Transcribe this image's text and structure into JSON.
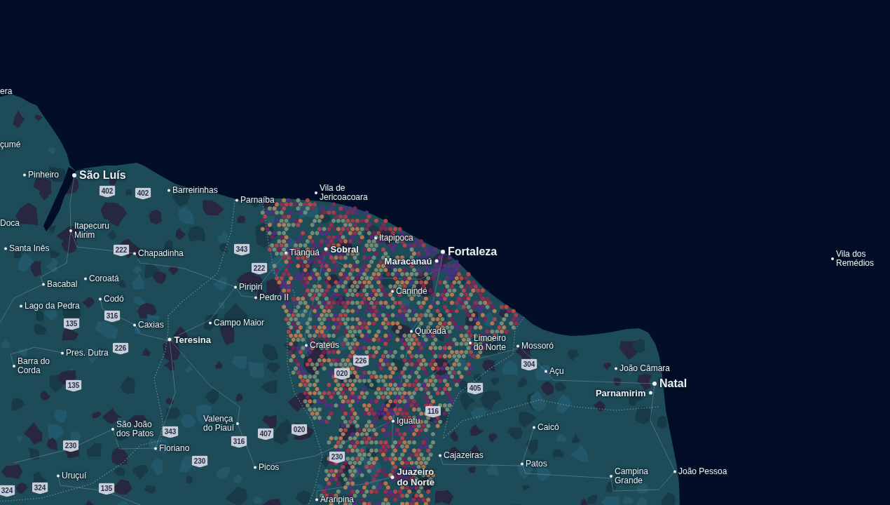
{
  "map": {
    "places": [
      {
        "name": "era",
        "kind": "edge"
      },
      {
        "name": "çumé",
        "kind": "edge"
      },
      {
        "name": "Pinheiro",
        "kind": "town"
      },
      {
        "name": "São Luís",
        "kind": "major"
      },
      {
        "name": "Barreirinhas",
        "kind": "town"
      },
      {
        "name": "Parnaíba",
        "kind": "town"
      },
      {
        "name": "Vila de Jericoacoara",
        "kind": "town"
      },
      {
        "name": "Doca",
        "kind": "edge"
      },
      {
        "name": "Itapecuru Mirim",
        "kind": "town"
      },
      {
        "name": "Itapipoca",
        "kind": "town"
      },
      {
        "name": "Santa Inês",
        "kind": "town"
      },
      {
        "name": "Chapadinha",
        "kind": "town"
      },
      {
        "name": "Tianguá",
        "kind": "town"
      },
      {
        "name": "Sobral",
        "kind": "city"
      },
      {
        "name": "Fortaleza",
        "kind": "major"
      },
      {
        "name": "Maracanaú",
        "kind": "city"
      },
      {
        "name": "Vila dos Remédios",
        "kind": "town"
      },
      {
        "name": "Coroatá",
        "kind": "town"
      },
      {
        "name": "Bacabal",
        "kind": "town"
      },
      {
        "name": "Piripiri",
        "kind": "town"
      },
      {
        "name": "Canindé",
        "kind": "town"
      },
      {
        "name": "Codó",
        "kind": "town"
      },
      {
        "name": "Pedro II",
        "kind": "town"
      },
      {
        "name": "Lago da Pedra",
        "kind": "town"
      },
      {
        "name": "Caxias",
        "kind": "town"
      },
      {
        "name": "Campo Maior",
        "kind": "town"
      },
      {
        "name": "Quixadá",
        "kind": "town"
      },
      {
        "name": "Teresina",
        "kind": "city"
      },
      {
        "name": "Crateús",
        "kind": "town"
      },
      {
        "name": "Limoeiro do Norte",
        "kind": "town"
      },
      {
        "name": "Mossoró",
        "kind": "town"
      },
      {
        "name": "Pres. Dutra",
        "kind": "town"
      },
      {
        "name": "Barra do Corda",
        "kind": "town"
      },
      {
        "name": "Açu",
        "kind": "town"
      },
      {
        "name": "João Câmara",
        "kind": "town"
      },
      {
        "name": "Natal",
        "kind": "major"
      },
      {
        "name": "Parnamirim",
        "kind": "city"
      },
      {
        "name": "São João dos Patos",
        "kind": "town"
      },
      {
        "name": "Valença do Piauí",
        "kind": "town"
      },
      {
        "name": "Iguatu",
        "kind": "town"
      },
      {
        "name": "Caicó",
        "kind": "town"
      },
      {
        "name": "Floriano",
        "kind": "town"
      },
      {
        "name": "Cajazeiras",
        "kind": "town"
      },
      {
        "name": "Picos",
        "kind": "town"
      },
      {
        "name": "Patos",
        "kind": "town"
      },
      {
        "name": "Uruçuí",
        "kind": "town"
      },
      {
        "name": "Juazeiro do Norte",
        "kind": "city"
      },
      {
        "name": "Campina Grande",
        "kind": "town"
      },
      {
        "name": "João Pessoa",
        "kind": "town"
      },
      {
        "name": "Araripina",
        "kind": "town"
      }
    ],
    "route_shields": [
      {
        "number": "402"
      },
      {
        "number": "402"
      },
      {
        "number": "222"
      },
      {
        "number": "343"
      },
      {
        "number": "222"
      },
      {
        "number": "316"
      },
      {
        "number": "135"
      },
      {
        "number": "226"
      },
      {
        "number": "226"
      },
      {
        "number": "304"
      },
      {
        "number": "020"
      },
      {
        "number": "135"
      },
      {
        "number": "405"
      },
      {
        "number": "116"
      },
      {
        "number": "343"
      },
      {
        "number": "407"
      },
      {
        "number": "020"
      },
      {
        "number": "230"
      },
      {
        "number": "316"
      },
      {
        "number": "230"
      },
      {
        "number": "230"
      },
      {
        "number": "324"
      },
      {
        "number": "324"
      },
      {
        "number": "135"
      }
    ]
  }
}
